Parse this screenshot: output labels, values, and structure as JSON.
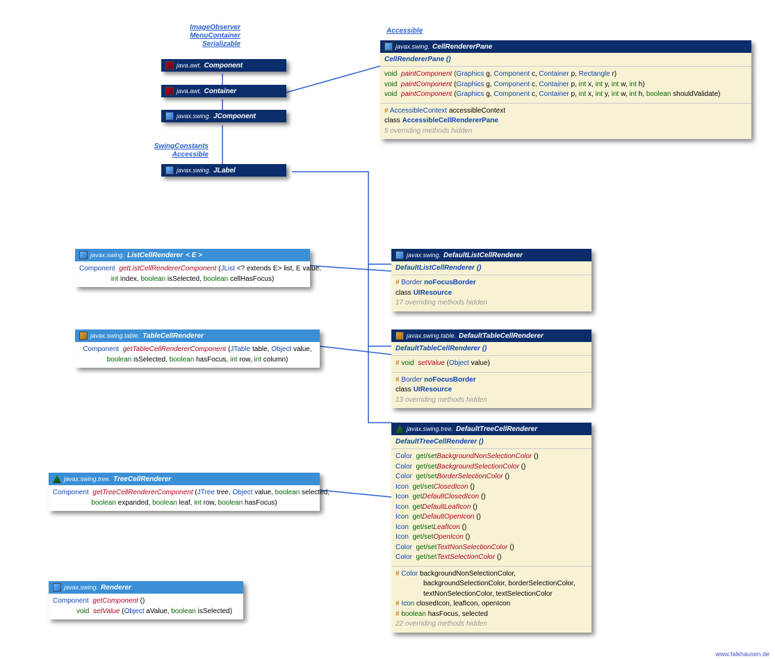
{
  "interfaces1": {
    "a": "ImageObserver",
    "b": "MenuContainer",
    "c": "Serializable"
  },
  "interfaces2": {
    "a": "SwingConstants",
    "b": "Accessible"
  },
  "accessible": "Accessible",
  "component": {
    "pkg": "java.awt.",
    "name": "Component"
  },
  "container": {
    "pkg": "java.awt.",
    "name": "Container"
  },
  "jcomponent": {
    "pkg": "javax.swing.",
    "name": "JComponent"
  },
  "jlabel": {
    "pkg": "javax.swing.",
    "name": "JLabel"
  },
  "crp": {
    "pkg": "javax.swing.",
    "name": "CellRendererPane",
    "ctor": "CellRendererPane ()",
    "m1": {
      "ret": "void",
      "name": "paintComponent",
      "args": "(Graphics g, Component c, Container p, Rectangle r)"
    },
    "m2": {
      "ret": "void",
      "name": "paintComponent",
      "args": "(Graphics g, Component c, Container p, int x, int y, int w, int h)"
    },
    "m3": {
      "ret": "void",
      "name": "paintComponent",
      "args": "(Graphics g, Component c, Container p, int x, int y, int w, int h, boolean shouldValidate)"
    },
    "f1": {
      "pfx": "#",
      "type": "AccessibleContext",
      "name": "accessibleContext"
    },
    "inner": "AccessibleCellRendererPane",
    "hidden": "5 overriding methods hidden"
  },
  "lcr": {
    "pkg": "javax.swing.",
    "name": "ListCellRenderer",
    "tparam": "< E >",
    "ret": "Component",
    "method": "getListCellRendererComponent",
    "a1": "(JList < ? extends E> list, E value,",
    "a2": "int index, boolean isSelected, boolean cellHasFocus)"
  },
  "tcr": {
    "pkg": "javax.swing.table.",
    "name": "TableCellRenderer",
    "ret": "Component",
    "method": "getTableCellRendererComponent",
    "a1": "(JTable table, Object value,",
    "a2": "boolean isSelected, boolean hasFocus, int row, int column)"
  },
  "treecr": {
    "pkg": "javax.swing.tree.",
    "name": "TreeCellRenderer",
    "ret": "Component",
    "method": "getTreeCellRendererComponent",
    "a1": "(JTree tree, Object value, boolean selected,",
    "a2": "boolean expanded, boolean leaf, int row, boolean hasFocus)"
  },
  "renderer": {
    "pkg": "javax.swing.",
    "name": "Renderer",
    "m1": {
      "ret": "Component",
      "name": "getComponent",
      "args": "()"
    },
    "m2": {
      "ret": "void",
      "name": "setValue",
      "args": "(Object aValue, boolean isSelected)"
    }
  },
  "dlcr": {
    "pkg": "javax.swing.",
    "name": "DefaultListCellRenderer",
    "ctor": "DefaultListCellRenderer ()",
    "f1": {
      "pfx": "#",
      "type": "Border",
      "name": "noFocusBorder"
    },
    "inner": "UIResource",
    "hidden": "17 overriding methods hidden"
  },
  "dtcr": {
    "pkg": "javax.swing.table.",
    "name": "DefaultTableCellRenderer",
    "ctor": "DefaultTableCellRenderer ()",
    "m1": {
      "pfx": "#",
      "ret": "void",
      "name": "setValue",
      "args": "(Object value)"
    },
    "f1": {
      "pfx": "#",
      "type": "Border",
      "name": "noFocusBorder"
    },
    "inner": "UIResource",
    "hidden": "13 overriding methods hidden"
  },
  "dtreecr": {
    "pkg": "javax.swing.tree.",
    "name": "DefaultTreeCellRenderer",
    "ctor": "DefaultTreeCellRenderer ()",
    "m": [
      {
        "ret": "Color",
        "gs": "get/set",
        "name": "BackgroundNonSelectionColor",
        "args": "()"
      },
      {
        "ret": "Color",
        "gs": "get/set",
        "name": "BackgroundSelectionColor",
        "args": "()"
      },
      {
        "ret": "Color",
        "gs": "get/set",
        "name": "BorderSelectionColor",
        "args": "()"
      },
      {
        "ret": "Icon",
        "gs": "get/set",
        "name": "ClosedIcon",
        "args": "()"
      },
      {
        "ret": "Icon",
        "gs": "get",
        "name": "DefaultClosedIcon",
        "args": "()"
      },
      {
        "ret": "Icon",
        "gs": "get",
        "name": "DefaultLeafIcon",
        "args": "()"
      },
      {
        "ret": "Icon",
        "gs": "get",
        "name": "DefaultOpenIcon",
        "args": "()"
      },
      {
        "ret": "Icon",
        "gs": "get/set",
        "name": "LeafIcon",
        "args": "()"
      },
      {
        "ret": "Icon",
        "gs": "get/set",
        "name": "OpenIcon",
        "args": "()"
      },
      {
        "ret": "Color",
        "gs": "get/set",
        "name": "TextNonSelectionColor",
        "args": "()"
      },
      {
        "ret": "Color",
        "gs": "get/set",
        "name": "TextSelectionColor",
        "args": "()"
      }
    ],
    "f1": {
      "pfx": "#",
      "type": "Color",
      "name": "backgroundNonSelectionColor,",
      "cont": "backgroundSelectionColor, borderSelectionColor,",
      "cont2": "textNonSelectionColor, textSelectionColor"
    },
    "f2": {
      "pfx": "#",
      "type": "Icon",
      "name": "closedIcon, leafIcon, openIcon"
    },
    "f3": {
      "pfx": "#",
      "type": "boolean",
      "name": "hasFocus, selected"
    },
    "hidden": "22 overriding methods hidden"
  },
  "watermark": "www.falkhausen.de",
  "labels": {
    "classkw": "class"
  }
}
